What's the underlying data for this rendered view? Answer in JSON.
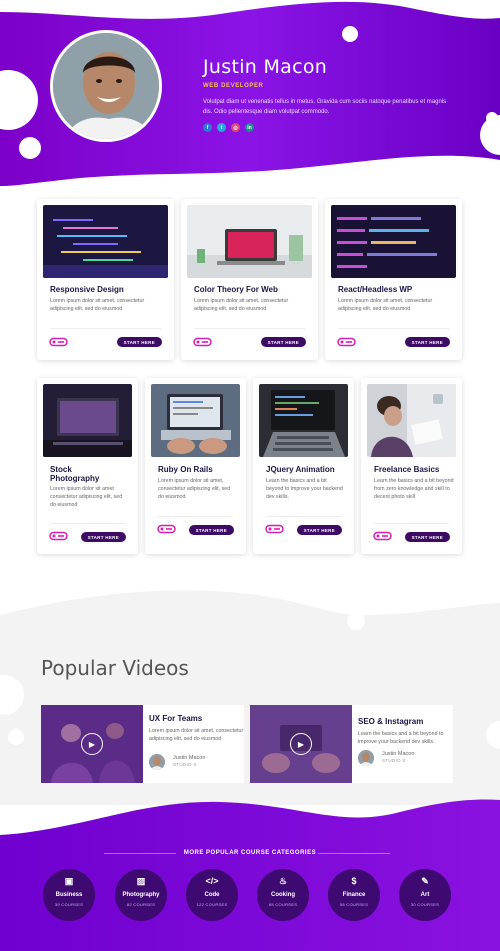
{
  "profile": {
    "name": "Justin Macon",
    "role": "WEB DEVELOPER",
    "bio": "Volutpat diam ut venenatis tellus in metus. Gravida cum sociis natoque penatibus et magnis dis. Odio pellentesque diam volutpat commodo.",
    "socials": [
      {
        "icon": "facebook-icon",
        "glyph": "f",
        "color": "#2d77d6"
      },
      {
        "icon": "twitter-icon",
        "glyph": "t",
        "color": "#2aa9e0"
      },
      {
        "icon": "instagram-icon",
        "glyph": "◎",
        "color": "#e0467a"
      },
      {
        "icon": "linkedin-icon",
        "glyph": "in",
        "color": "#1c8f8a"
      }
    ]
  },
  "courses": [
    {
      "title": "Responsive Design",
      "desc": "Lorem ipsum dolor sit amet, consectetur adipiscing elit, sed do eiusmod",
      "button": "START HERE"
    },
    {
      "title": "Color Theory For Web",
      "desc": "Lorem ipsum dolor sit amet, consectetur adipiscing elit, sed do eiusmod",
      "button": "START HERE"
    },
    {
      "title": "React/Headless WP",
      "desc": "Lorem ipsum dolor sit amet, consectetur adipiscing elit, sed do eiusmod",
      "button": "START HERE"
    },
    {
      "title": "Stock Photography",
      "desc": "Lorem ipsum dolor sit amet consectetur adipiscing elit, sed do eiusmod",
      "button": "START HERE"
    },
    {
      "title": "Ruby On Rails",
      "desc": "Lorem ipsum dolor sit amet, consectetur adipiscing elit, sed do eiusmod",
      "button": "START HERE"
    },
    {
      "title": "JQuery Animation",
      "desc": "Learn the basics and a bit beyond to improve your backend dev skills.",
      "button": "START HERE"
    },
    {
      "title": "Freelance Basics",
      "desc": "Learn the basics and a bit beyond from zero knowledge and skill to decent photo skill",
      "button": "START HERE"
    }
  ],
  "popular": {
    "title": "Popular Videos",
    "videos": [
      {
        "title": "UX For Teams",
        "desc": "Lorem ipsum dolor sit amet, consectetur adipiscing elit, sed do eiusmod",
        "author": "Justin Macon",
        "studio": "STUDIO X"
      },
      {
        "title": "SEO & Instagram",
        "desc": "Learn the basics and a bit beyond to improve your backend dev skills.",
        "author": "Justin Macon",
        "studio": "STUDIO X"
      }
    ]
  },
  "categories": {
    "title": "MORE POPULAR COURSE CATEGORIES",
    "items": [
      {
        "name": "Business",
        "count": "39 COURSES",
        "icon": "briefcase-icon",
        "glyph": "▣"
      },
      {
        "name": "Photography",
        "count": "82 COURSES",
        "icon": "image-icon",
        "glyph": "▨"
      },
      {
        "name": "Code",
        "count": "122 COURSES",
        "icon": "code-icon",
        "glyph": "</>"
      },
      {
        "name": "Cooking",
        "count": "65 COURSES",
        "icon": "utensils-icon",
        "glyph": "♨"
      },
      {
        "name": "Finance",
        "count": "58 COURSES",
        "icon": "dollar-icon",
        "glyph": "$"
      },
      {
        "name": "Art",
        "count": "30 COURSES",
        "icon": "brush-icon",
        "glyph": "✎"
      }
    ]
  },
  "colors": {
    "brand_purple": "#7a00d9",
    "deep_purple": "#3d0a64",
    "accent_yellow": "#f7c24a"
  }
}
